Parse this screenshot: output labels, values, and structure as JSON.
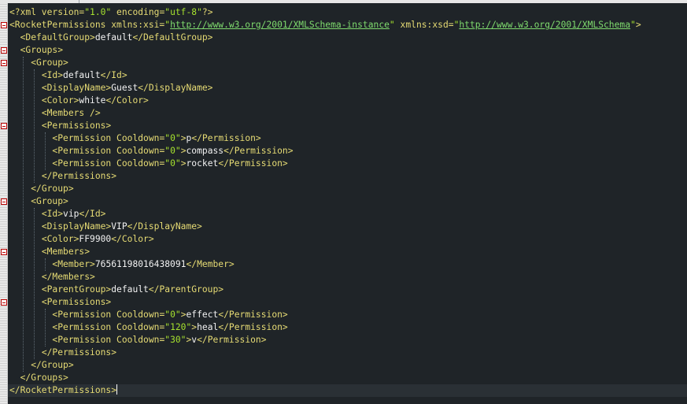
{
  "editor": {
    "lines": [
      "<?xml version=\"1.0\" encoding=\"utf-8\"?>",
      "<RocketPermissions xmlns:xsi=\"http://www.w3.org/2001/XMLSchema-instance\" xmlns:xsd=\"http://www.w3.org/2001/XMLSchema\">",
      "  <DefaultGroup>default</DefaultGroup>",
      "  <Groups>",
      "    <Group>",
      "      <Id>default</Id>",
      "      <DisplayName>Guest</DisplayName>",
      "      <Color>white</Color>",
      "      <Members />",
      "      <Permissions>",
      "        <Permission Cooldown=\"0\">p</Permission>",
      "        <Permission Cooldown=\"0\">compass</Permission>",
      "        <Permission Cooldown=\"0\">rocket</Permission>",
      "      </Permissions>",
      "    </Group>",
      "    <Group>",
      "      <Id>vip</Id>",
      "      <DisplayName>VIP</DisplayName>",
      "      <Color>FF9900</Color>",
      "      <Members>",
      "        <Member>76561198016438091</Member>",
      "      </Members>",
      "      <ParentGroup>default</ParentGroup>",
      "      <Permissions>",
      "        <Permission Cooldown=\"0\">effect</Permission>",
      "        <Permission Cooldown=\"120\">heal</Permission>",
      "        <Permission Cooldown=\"30\">v</Permission>",
      "      </Permissions>",
      "    </Group>",
      "  </Groups>",
      "</RocketPermissions>"
    ],
    "current_line": 31,
    "fold_lines": [
      2,
      4,
      5,
      10,
      16,
      20,
      24
    ],
    "colors": {
      "background": "#1f2428",
      "tag": "#e6db74",
      "text": "#f2f2f2",
      "attribute_value": "#a6e22e",
      "url": "#7fdc6e",
      "fold_marker": "#b90000"
    },
    "icons": [
      "fold-minus-icon"
    ]
  }
}
